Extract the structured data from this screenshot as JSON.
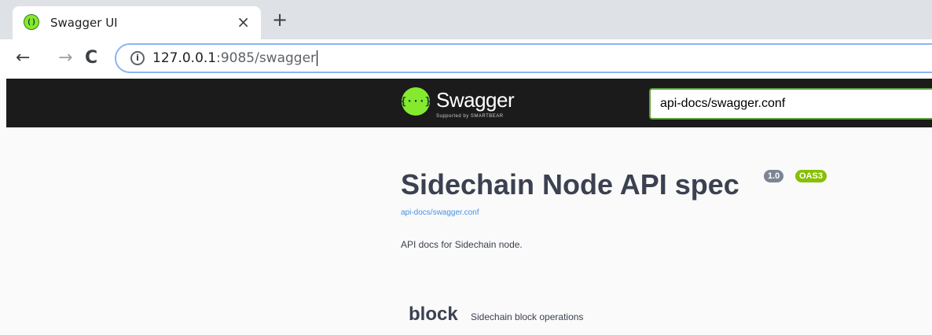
{
  "browser": {
    "tab_title": "Swagger UI",
    "tab_close": "×",
    "new_tab": "+",
    "back": "←",
    "forward": "→",
    "reload": "C",
    "url_host": "127.0.0.1",
    "url_path": ":9085/swagger"
  },
  "topbar": {
    "logo_icon": "{···}",
    "logo_text": "Swagger",
    "logo_sub": "Supported by SMARTBEAR",
    "spec_url": "api-docs/swagger.conf",
    "accent_color": "#85ea2d"
  },
  "info": {
    "title": "Sidechain Node API spec",
    "version_badge": "1.0",
    "oas_badge": "OAS3",
    "spec_link": "api-docs/swagger.conf",
    "description": "API docs for Sidechain node."
  },
  "tags": [
    {
      "name": "block",
      "description": "Sidechain block operations"
    }
  ]
}
